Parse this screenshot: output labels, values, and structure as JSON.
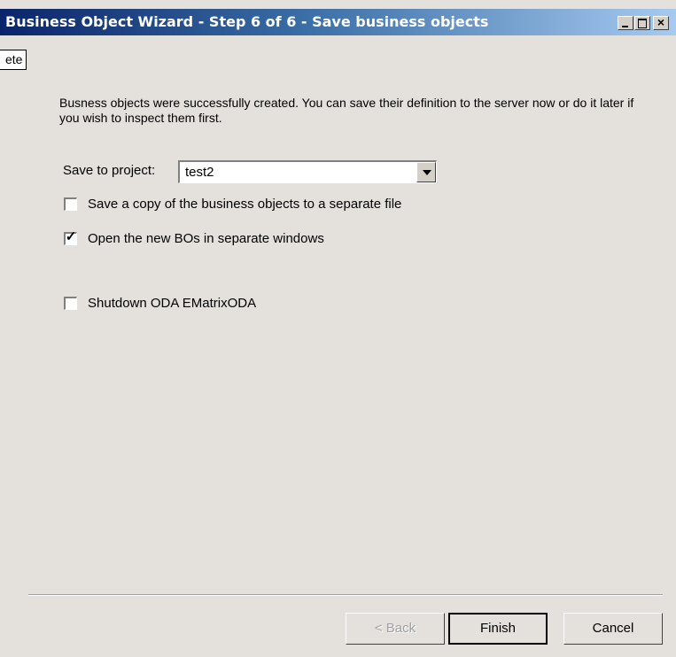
{
  "window": {
    "title": "Business Object Wizard - Step 6 of 6 - Save business objects",
    "controls": [
      "minimize-icon",
      "maximize-icon",
      "close-icon"
    ]
  },
  "tooltip": {
    "text": "ete"
  },
  "description": "Busness objects were successfully created. You can save their definition to the server now or do it later if you wish to inspect them first.",
  "save_project": {
    "label": "Save to project:",
    "value": "test2"
  },
  "options": [
    {
      "label": "Save a copy of the business objects to a separate file",
      "checked": false
    },
    {
      "label": "Open the new BOs in separate windows",
      "checked": true
    },
    {
      "label": "Shutdown ODA EMatrixODA",
      "checked": false
    }
  ],
  "buttons": {
    "back": "< Back",
    "finish": "Finish",
    "cancel": "Cancel"
  },
  "colors": {
    "title_start": "#0a246a",
    "title_end": "#a6caf0",
    "dialog_bg": "#e4e1dc"
  }
}
